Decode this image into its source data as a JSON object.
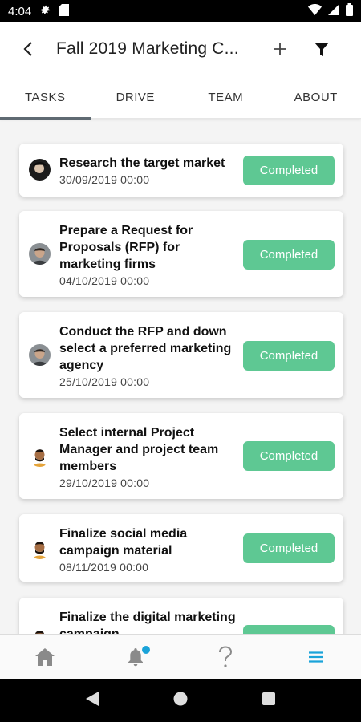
{
  "status_bar": {
    "time": "4:04"
  },
  "app_bar": {
    "title": "Fall 2019 Marketing C..."
  },
  "tabs": [
    {
      "label": "TASKS",
      "active": true
    },
    {
      "label": "DRIVE"
    },
    {
      "label": "TEAM"
    },
    {
      "label": "ABOUT"
    }
  ],
  "tasks": [
    {
      "title": "Research the target market",
      "date": "30/09/2019 00:00",
      "status": "Completed",
      "avatar": "avatar-1"
    },
    {
      "title": "Prepare a Request for Proposals (RFP) for marketing firms",
      "date": "04/10/2019 00:00",
      "status": "Completed",
      "avatar": "avatar-2"
    },
    {
      "title": "Conduct the RFP and down select a preferred marketing agency",
      "date": "25/10/2019 00:00",
      "status": "Completed",
      "avatar": "avatar-2"
    },
    {
      "title": "Select internal Project Manager and project team members",
      "date": "29/10/2019 00:00",
      "status": "Completed",
      "avatar": "avatar-3"
    },
    {
      "title": "Finalize social media campaign material",
      "date": "08/11/2019 00:00",
      "status": "Completed",
      "avatar": "avatar-3"
    },
    {
      "title": "Finalize the digital marketing campaign",
      "date": "",
      "status": "Completed",
      "avatar": "avatar-3"
    }
  ],
  "bottom_nav": [
    "home-icon",
    "bell-icon",
    "help-icon",
    "menu-icon"
  ],
  "colors": {
    "completed": "#5ec893",
    "accent": "#1aa3d9"
  }
}
